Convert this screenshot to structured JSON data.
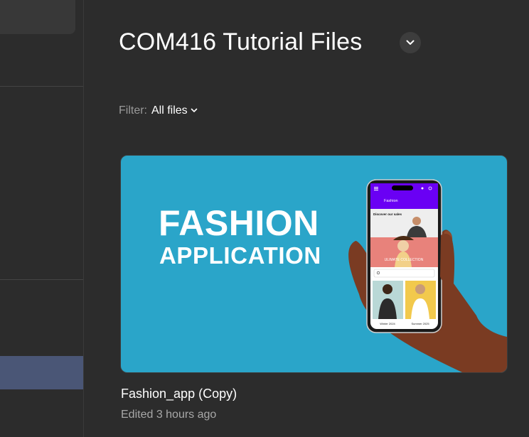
{
  "header": {
    "title": "COM416 Tutorial Files",
    "dropdown_icon": "chevron-down-icon"
  },
  "filter": {
    "label": "Filter:",
    "value": "All files"
  },
  "file": {
    "name": "Fashion_app (Copy)",
    "edited": "Edited 3 hours ago",
    "thumbnail": {
      "line1": "FASHION",
      "line2": "APPLICATION",
      "background": "#2aa5c9",
      "phone": {
        "app_title": "Fashion",
        "section": "Discover our sales",
        "banner": "ULIMATE COLLECTION",
        "product1": "Winter 2024",
        "product2": "Summer 2025",
        "header_color": "#6a00f4"
      }
    }
  },
  "colors": {
    "background": "#2c2c2c",
    "sidebar_active": "#4a5676"
  }
}
